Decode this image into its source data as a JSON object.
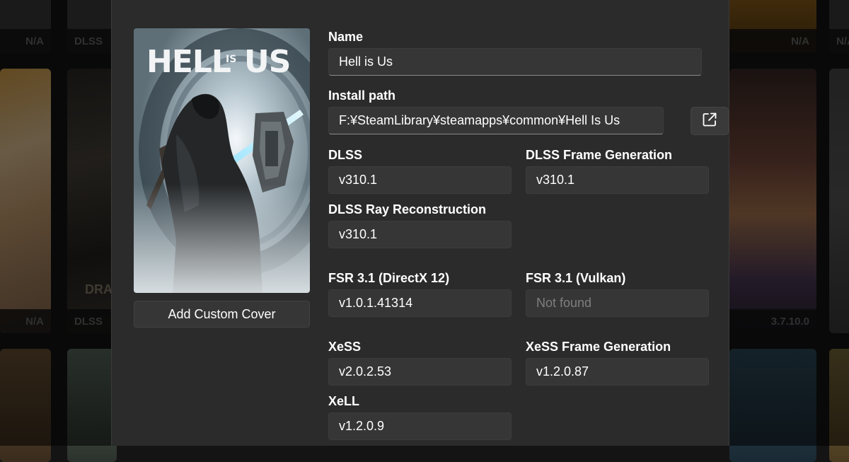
{
  "background": {
    "left_badges": [
      "N/A",
      "N/A"
    ],
    "col2_badges": [
      "DLSS",
      "DLSS"
    ],
    "right_badges": [
      "N/A",
      "N/A"
    ],
    "right_col_badge": "3.7.10.0",
    "partial_text": "DRA"
  },
  "dialog": {
    "cover": {
      "title_part1": "HELL",
      "title_part2": "IS",
      "title_part3": "US",
      "button_label": "Add Custom Cover"
    },
    "name": {
      "label": "Name",
      "value": "Hell is Us"
    },
    "install_path": {
      "label": "Install path",
      "value": "F:¥SteamLibrary¥steamapps¥common¥Hell Is Us",
      "open_icon": "external-link-icon"
    },
    "dlss": {
      "label": "DLSS",
      "value": "v310.1"
    },
    "dlss_fg": {
      "label": "DLSS Frame Generation",
      "value": "v310.1"
    },
    "dlss_rr": {
      "label": "DLSS Ray Reconstruction",
      "value": "v310.1"
    },
    "fsr_dx12": {
      "label": "FSR 3.1 (DirectX 12)",
      "value": "v1.0.1.41314"
    },
    "fsr_vulkan": {
      "label": "FSR 3.1 (Vulkan)",
      "value": "Not found"
    },
    "xess": {
      "label": "XeSS",
      "value": "v2.0.2.53"
    },
    "xess_fg": {
      "label": "XeSS Frame Generation",
      "value": "v1.2.0.87"
    },
    "xell": {
      "label": "XeLL",
      "value": "v1.2.0.9"
    }
  }
}
